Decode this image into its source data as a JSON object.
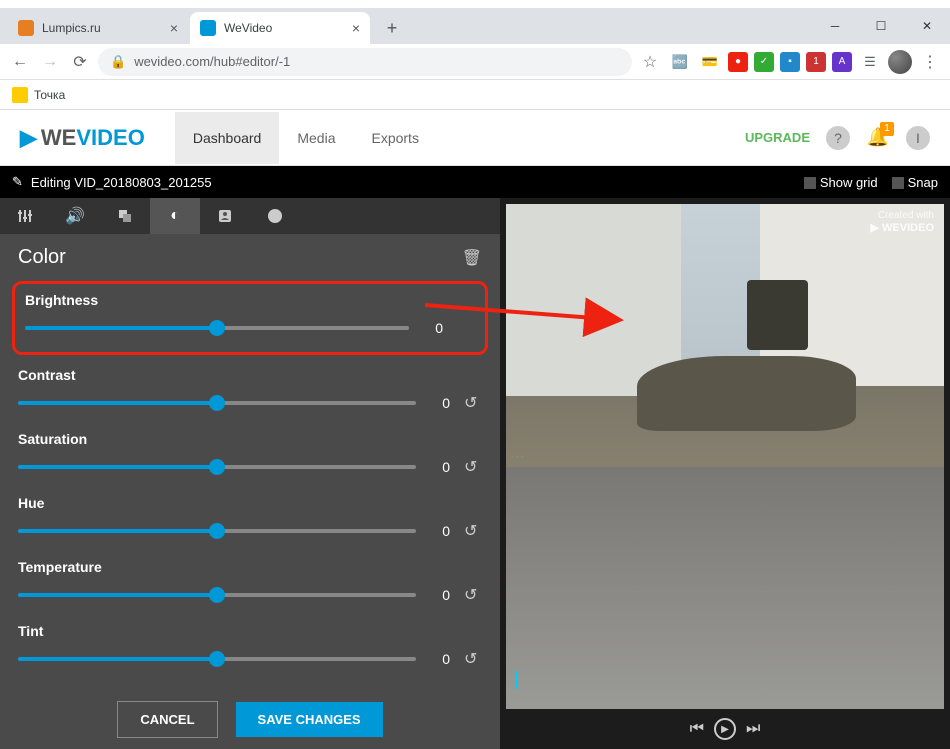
{
  "browser": {
    "tabs": [
      {
        "title": "Lumpics.ru",
        "favicon_color": "#e67e22",
        "active": false
      },
      {
        "title": "WeVideo",
        "favicon_color": "#0098d7",
        "active": true
      }
    ],
    "url": "wevideo.com/hub#editor/-1",
    "bookmark": "Точка"
  },
  "header": {
    "logo_we": "WE",
    "logo_video": "VIDEO",
    "tabs": [
      "Dashboard",
      "Media",
      "Exports"
    ],
    "active_tab": 0,
    "upgrade": "UPGRADE",
    "notif_badge": "1",
    "user_initial": "I"
  },
  "editor_bar": {
    "title": "Editing VID_20180803_201255",
    "show_grid": "Show grid",
    "snap": "Snap"
  },
  "panel": {
    "title": "Color",
    "sliders": [
      {
        "label": "Brightness",
        "value": "0",
        "highlighted": true,
        "show_reset": false
      },
      {
        "label": "Contrast",
        "value": "0",
        "highlighted": false,
        "show_reset": true
      },
      {
        "label": "Saturation",
        "value": "0",
        "highlighted": false,
        "show_reset": true
      },
      {
        "label": "Hue",
        "value": "0",
        "highlighted": false,
        "show_reset": true
      },
      {
        "label": "Temperature",
        "value": "0",
        "highlighted": false,
        "show_reset": true
      },
      {
        "label": "Tint",
        "value": "0",
        "highlighted": false,
        "show_reset": true
      }
    ],
    "cancel": "CANCEL",
    "save": "SAVE CHANGES"
  },
  "preview": {
    "watermark_top": "Created with",
    "watermark_brand": "WEVIDEO"
  }
}
